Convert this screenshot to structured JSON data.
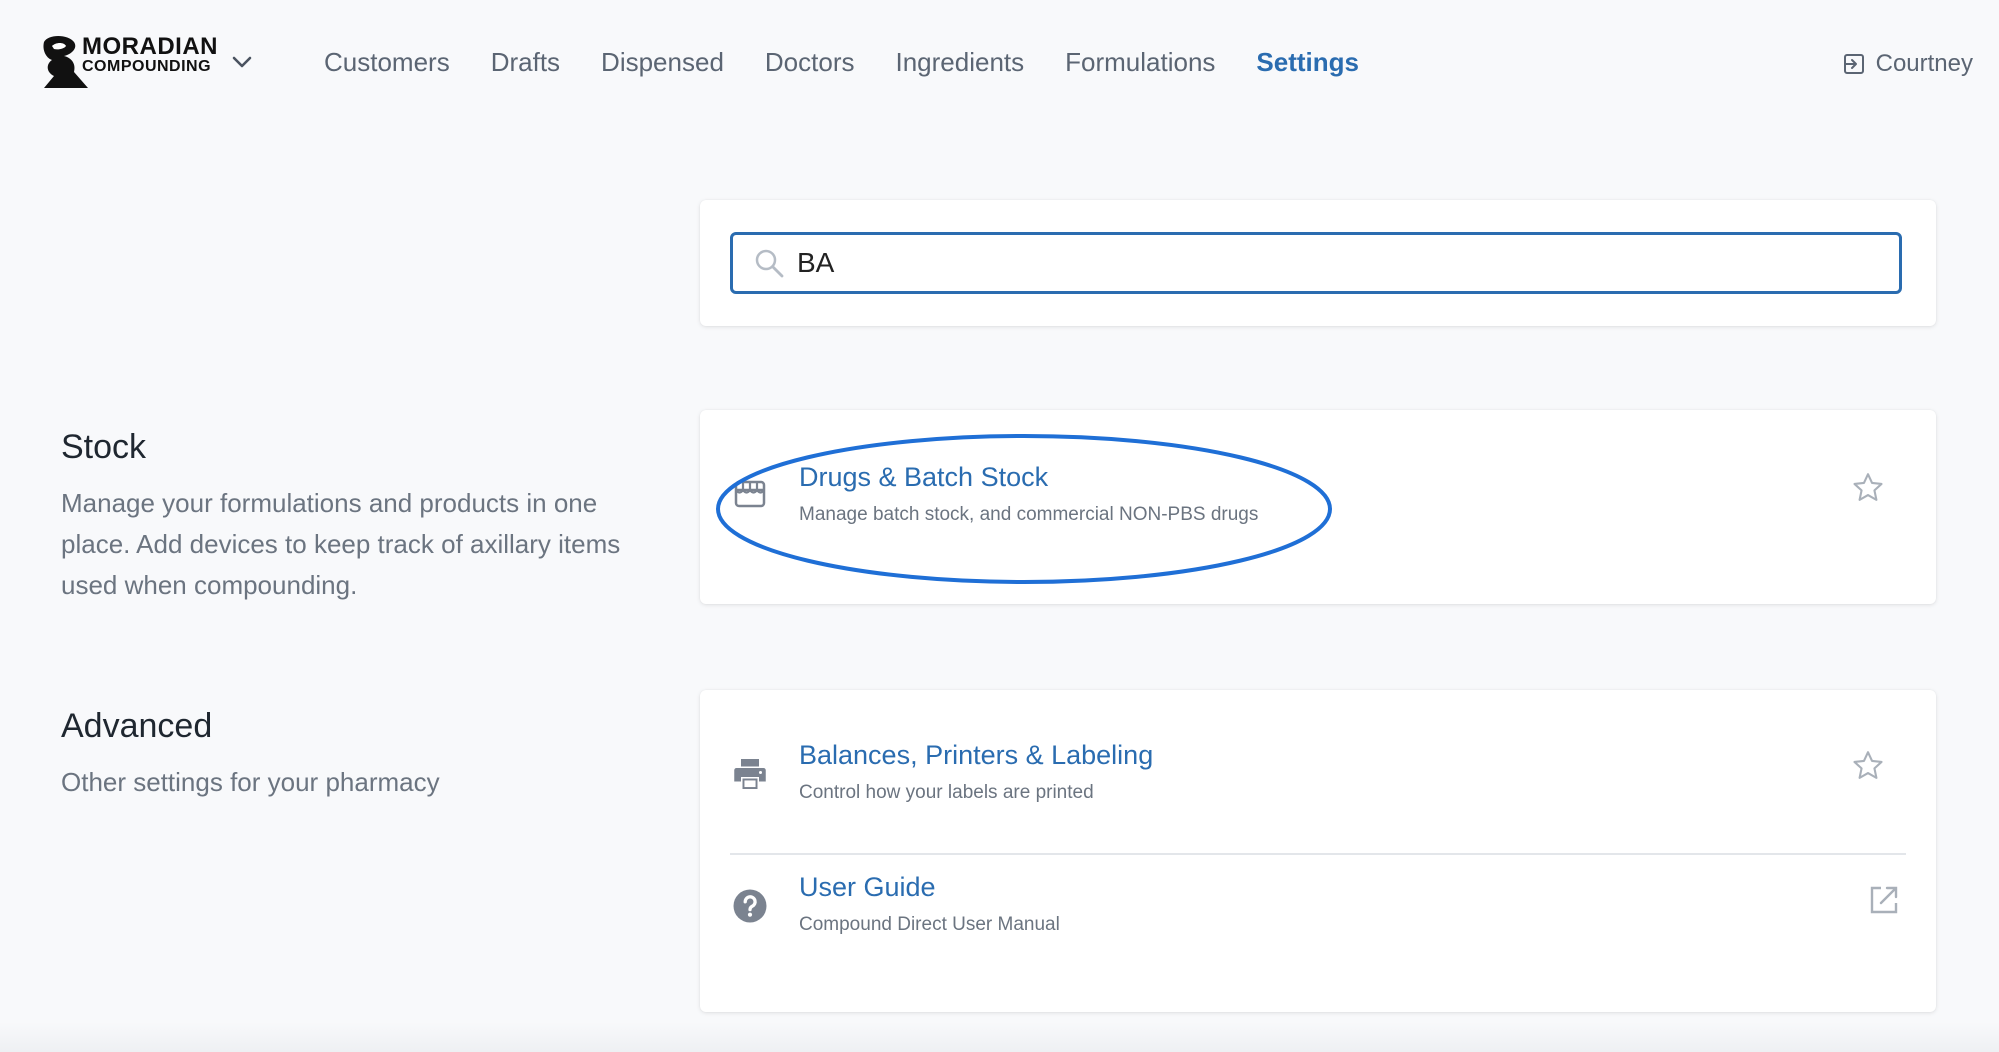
{
  "brand": {
    "line1": "MORADIAN",
    "line2": "COMPOUNDING"
  },
  "nav": {
    "items": [
      {
        "label": "Customers",
        "active": false
      },
      {
        "label": "Drafts",
        "active": false
      },
      {
        "label": "Dispensed",
        "active": false
      },
      {
        "label": "Doctors",
        "active": false
      },
      {
        "label": "Ingredients",
        "active": false
      },
      {
        "label": "Formulations",
        "active": false
      },
      {
        "label": "Settings",
        "active": true
      }
    ]
  },
  "user": {
    "name": "Courtney",
    "icon": "logout-icon"
  },
  "search": {
    "value": "BA",
    "icon": "search-icon"
  },
  "sections": {
    "stock": {
      "title": "Stock",
      "description": "Manage your formulations and products in one place. Add devices to keep track of axillary items used when compounding.",
      "items": [
        {
          "title": "Drugs & Batch Stock",
          "subtitle": "Manage batch stock, and commercial NON-PBS drugs",
          "icon": "store-icon",
          "action": "star-icon",
          "highlighted": true
        }
      ]
    },
    "advanced": {
      "title": "Advanced",
      "description": "Other settings for your pharmacy",
      "items": [
        {
          "title": "Balances, Printers & Labeling",
          "subtitle": "Control how your labels are printed",
          "icon": "printer-icon",
          "action": "star-icon"
        },
        {
          "title": "User Guide",
          "subtitle": "Compound Direct User Manual",
          "icon": "help-icon",
          "action": "external-link-icon"
        }
      ]
    }
  },
  "colors": {
    "accent": "#2a6cb0",
    "text": "#3c4653",
    "muted": "#6b7480",
    "background": "#f8f9fb",
    "highlight": "#1f6fd6"
  }
}
